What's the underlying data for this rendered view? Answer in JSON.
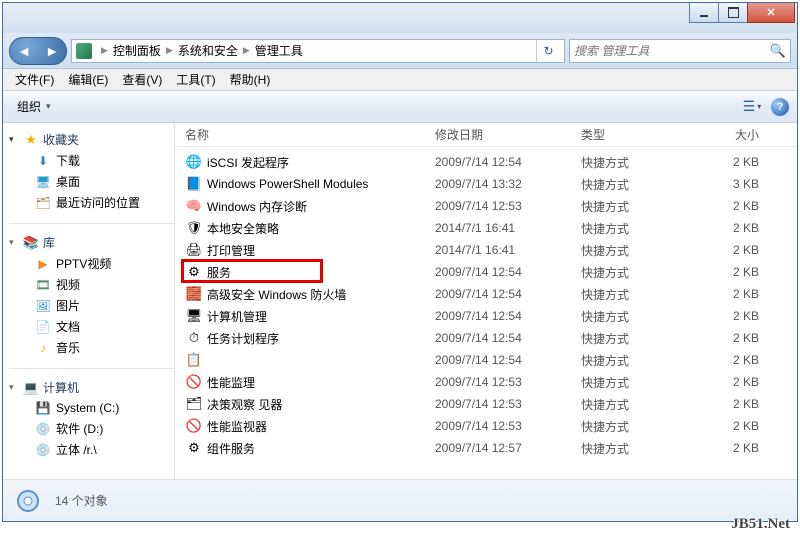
{
  "breadcrumb": {
    "items": [
      "控制面板",
      "系统和安全",
      "管理工具"
    ]
  },
  "search": {
    "placeholder": "搜索 管理工具"
  },
  "menu": {
    "file": "文件(F)",
    "edit": "编辑(E)",
    "view": "查看(V)",
    "tools": "工具(T)",
    "help": "帮助(H)"
  },
  "toolbar": {
    "organize": "组织"
  },
  "sidebar": {
    "favorites": {
      "label": "收藏夹",
      "items": [
        {
          "label": "下载"
        },
        {
          "label": "桌面"
        },
        {
          "label": "最近访问的位置"
        }
      ]
    },
    "libraries": {
      "label": "库",
      "items": [
        {
          "label": "PPTV视频"
        },
        {
          "label": "视频"
        },
        {
          "label": "图片"
        },
        {
          "label": "文档"
        },
        {
          "label": "音乐"
        }
      ]
    },
    "computer": {
      "label": "计算机",
      "items": [
        {
          "label": "System (C:)"
        },
        {
          "label": "软件 (D:)"
        },
        {
          "label": "立体 /r.\\"
        }
      ]
    }
  },
  "columns": {
    "name": "名称",
    "date": "修改日期",
    "type": "类型",
    "size": "大小"
  },
  "files": [
    {
      "icon": "🌐",
      "name": "iSCSI 发起程序",
      "date": "2009/7/14 12:54",
      "type": "快捷方式",
      "size": "2 KB"
    },
    {
      "icon": "📘",
      "name": "Windows PowerShell Modules",
      "date": "2009/7/14 13:32",
      "type": "快捷方式",
      "size": "3 KB"
    },
    {
      "icon": "🧠",
      "name": "Windows 内存诊断",
      "date": "2009/7/14 12:53",
      "type": "快捷方式",
      "size": "2 KB"
    },
    {
      "icon": "🛡",
      "name": "本地安全策略",
      "date": "2014/7/1 16:41",
      "type": "快捷方式",
      "size": "2 KB"
    },
    {
      "icon": "🖨",
      "name": "打印管理",
      "date": "2014/7/1 16:41",
      "type": "快捷方式",
      "size": "2 KB"
    },
    {
      "icon": "⚙",
      "name": "服务",
      "date": "2009/7/14 12:54",
      "type": "快捷方式",
      "size": "2 KB"
    },
    {
      "icon": "🧱",
      "name": "高级安全 Windows 防火墙",
      "date": "2009/7/14 12:54",
      "type": "快捷方式",
      "size": "2 KB"
    },
    {
      "icon": "🖥",
      "name": "计算机管理",
      "date": "2009/7/14 12:54",
      "type": "快捷方式",
      "size": "2 KB"
    },
    {
      "icon": "⏱",
      "name": "任务计划程序",
      "date": "2009/7/14 12:54",
      "type": "快捷方式",
      "size": "2 KB"
    },
    {
      "icon": "📋",
      "name": "",
      "date": "2009/7/14 12:54",
      "type": "快捷方式",
      "size": "2 KB"
    },
    {
      "icon": "🚫",
      "name": "性能监理",
      "date": "2009/7/14 12:53",
      "type": "快捷方式",
      "size": "2 KB"
    },
    {
      "icon": "🗂",
      "name": "决策观察      见器",
      "date": "2009/7/14 12:53",
      "type": "快捷方式",
      "size": "2 KB"
    },
    {
      "icon": "🚫",
      "name": "性能监视器",
      "date": "2009/7/14 12:53",
      "type": "快捷方式",
      "size": "2 KB"
    },
    {
      "icon": "⚙",
      "name": "组件服务",
      "date": "2009/7/14 12:57",
      "type": "快捷方式",
      "size": "2 KB"
    }
  ],
  "status": {
    "count": "14 个对象"
  },
  "watermark": "JB51.Net"
}
